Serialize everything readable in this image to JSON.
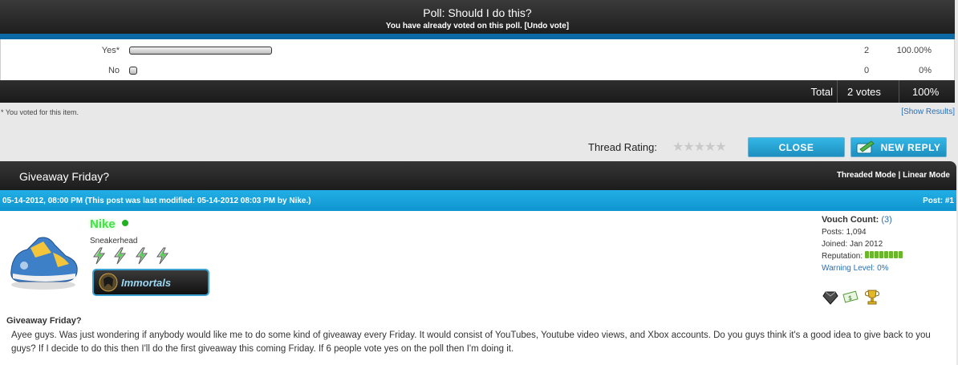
{
  "poll": {
    "title": "Poll: Should I do this?",
    "subtitle": "You have already voted on this poll. [Undo vote]",
    "options": [
      {
        "label": "Yes*",
        "votes": "2",
        "percent": "100.00%",
        "share": 1.0
      },
      {
        "label": "No",
        "votes": "0",
        "percent": "0%",
        "share": 0.0
      }
    ],
    "total_label": "Total",
    "total_votes": "2 votes",
    "total_percent": "100%",
    "note": "* You voted for this item.",
    "show_results": "[Show Results]"
  },
  "thread": {
    "rating_label": "Thread Rating:",
    "rating_stars": 0,
    "stars_display": "★★★★★",
    "close_label": "CLOSE",
    "reply_label": "NEW REPLY",
    "title": "Giveaway Friday?",
    "threaded_mode": "Threaded Mode",
    "mode_sep": "|",
    "linear_mode": "Linear Mode"
  },
  "post": {
    "date_line": "05-14-2012, 08:00 PM (This post was last modified: 05-14-2012 08:03 PM by Nike.)",
    "number": "Post: #1",
    "author": {
      "name": "Nike",
      "title": "Sneakerhead",
      "group": "Immortals",
      "online_color": "#22b022",
      "name_color": "#49e04b"
    },
    "stats": {
      "vouch_label": "Vouch Count:",
      "vouch_value": "(3)",
      "posts": "Posts: 1,094",
      "joined": "Joined: Jan 2012",
      "reputation_label": "Reputation:",
      "reputation_pips": 8,
      "warning": "Warning Level: 0%"
    },
    "awards": [
      "diamond-icon",
      "money-hand-icon",
      "trophy-icon"
    ],
    "subject": "Giveaway Friday?",
    "message": "Ayee guys. Was just wondering if anybody would like me to do some kind of giveaway every Friday. It would consist of YouTubes, Youtube video views, and Xbox accounts. Do you guys think it's a good idea to give back to you guys? If I decide to do this then I'll do the first giveaway this coming Friday. If 6 people vote yes on the poll then I'm doing it."
  },
  "colors": {
    "accent_blue": "#0b6aa6",
    "post_bar": "#22aee6",
    "button": "#1d8fbf",
    "rep_green": "#6bb72b"
  }
}
